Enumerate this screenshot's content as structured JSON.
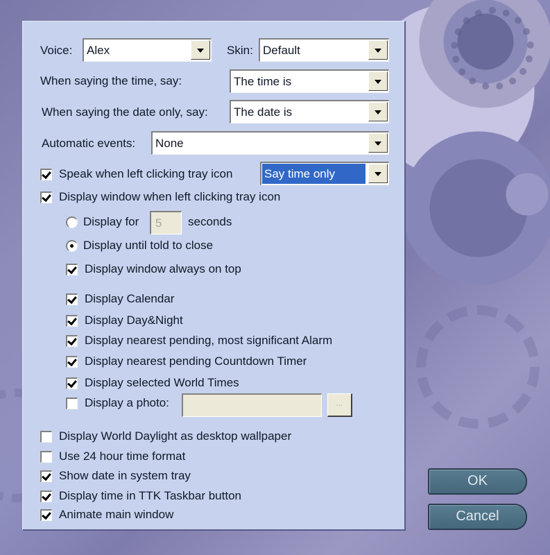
{
  "voice": {
    "label": "Voice:",
    "value": "Alex"
  },
  "skin": {
    "label": "Skin:",
    "value": "Default"
  },
  "say_time": {
    "label": "When saying the time, say:",
    "value": "The time is"
  },
  "say_date": {
    "label": "When saying the date only, say:",
    "value": "The date is"
  },
  "auto_events": {
    "label": "Automatic events:",
    "value": "None"
  },
  "speak_tray": {
    "label": "Speak when left clicking tray icon",
    "checked": true,
    "mode": "Say time only"
  },
  "display_tray": {
    "label": "Display window when left clicking tray icon",
    "checked": true
  },
  "display_for": {
    "label": "Display for",
    "seconds_value": "5",
    "suffix": "seconds",
    "selected": false
  },
  "display_until": {
    "label": "Display until told to close",
    "selected": true
  },
  "always_on_top": {
    "label": "Display window always on top",
    "checked": true
  },
  "display_options": [
    {
      "label": "Display Calendar",
      "checked": true
    },
    {
      "label": "Display Day&Night",
      "checked": true
    },
    {
      "label": "Display nearest pending, most significant Alarm",
      "checked": true
    },
    {
      "label": "Display nearest pending Countdown Timer",
      "checked": true
    },
    {
      "label": "Display selected World Times",
      "checked": true
    }
  ],
  "display_photo": {
    "label": "Display a photo:",
    "checked": false,
    "path": "",
    "browse_label": "..."
  },
  "general_options": [
    {
      "label": "Display World Daylight as desktop wallpaper",
      "checked": false
    },
    {
      "label": "Use 24 hour time format",
      "checked": false
    },
    {
      "label": "Show date in system tray",
      "checked": true
    },
    {
      "label": "Display time in TTK Taskbar button",
      "checked": true
    },
    {
      "label": "Animate main window",
      "checked": true
    }
  ],
  "buttons": {
    "ok": "OK",
    "cancel": "Cancel"
  }
}
